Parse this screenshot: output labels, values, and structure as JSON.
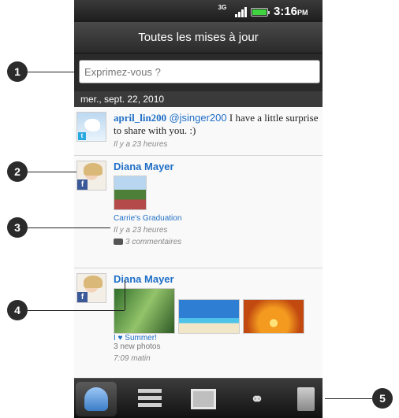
{
  "status_bar": {
    "network": "3G",
    "time": "3:16",
    "ampm": "PM"
  },
  "header": {
    "title": "Toutes les mises à jour"
  },
  "compose": {
    "placeholder": "Exprimez-vous ?"
  },
  "feed": {
    "date": "mer., sept. 22, 2010",
    "items": [
      {
        "service": "twitter-icon",
        "author": "april_lin200",
        "mention": "@jsinger200",
        "message": "I have a little surprise to share with you. :)",
        "time": "Il y a 23 heures"
      },
      {
        "service": "facebook-icon",
        "author": "Diana Mayer",
        "album": "Carrie's Graduation",
        "time": "Il y a 23 heures",
        "comments": "3 commentaires"
      },
      {
        "service": "facebook-icon",
        "author": "Diana Mayer",
        "album": "I ♥ Summer!",
        "photos_count": "3 new photos",
        "time": "7:09 matin"
      }
    ]
  },
  "tabs": [
    {
      "name": "people",
      "active": true
    },
    {
      "name": "updates",
      "active": false
    },
    {
      "name": "photos",
      "active": false
    },
    {
      "name": "links",
      "active": false
    },
    {
      "name": "profile",
      "active": false
    }
  ],
  "callouts": [
    "1",
    "2",
    "3",
    "4",
    "5"
  ],
  "colors": {
    "link_blue": "#1f6fc7",
    "facebook_blue": "#3b5998",
    "twitter_blue": "#29a9e1"
  }
}
